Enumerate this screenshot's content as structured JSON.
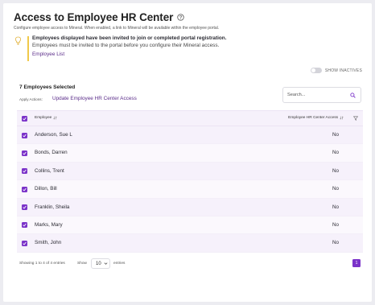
{
  "header": {
    "title": "Access to Employee HR Center",
    "subtitle": "Configure employee access to Mineral. When enabled, a link to Mineral will be available within the employee portal."
  },
  "info": {
    "title": "Employees displayed have been invited to join or completed portal registration.",
    "description": "Employees must be invited to the portal before you configure their Mineral access.",
    "link": "Employee List"
  },
  "toggle": {
    "label": "SHOW INACTIVES",
    "on": false
  },
  "card": {
    "selected_count": "7 Employees Selected",
    "apply_label": "Apply Actions:",
    "apply_link": "Update Employee HR Center Access",
    "search": {
      "placeholder": "Search...",
      "value": ""
    }
  },
  "table": {
    "columns": {
      "employee": "Employee",
      "access": "Employee HR Center Access"
    },
    "rows": [
      {
        "name": "Anderson, Sue L",
        "access": "No",
        "checked": true
      },
      {
        "name": "Bonds, Darren",
        "access": "No",
        "checked": true
      },
      {
        "name": "Collins, Trent",
        "access": "No",
        "checked": true
      },
      {
        "name": "Dillon, Bill",
        "access": "No",
        "checked": true
      },
      {
        "name": "Franklin, Sheila",
        "access": "No",
        "checked": true
      },
      {
        "name": "Marks, Mary",
        "access": "No",
        "checked": true
      },
      {
        "name": "Smith, John",
        "access": "No",
        "checked": true
      }
    ]
  },
  "footer": {
    "showing": "Showing 1 to 4 of 4 entries",
    "show_label": "Show",
    "page_size": "10",
    "entries_label": "entries",
    "current_page": "1"
  },
  "colors": {
    "accent": "#7b33c9",
    "link": "#5b2d8a",
    "info_bar": "#f0c94a",
    "row_tint": "#f6f1fb"
  },
  "icons": [
    "help-circle-icon",
    "lightbulb-icon",
    "search-icon",
    "sort-icon",
    "filter-icon",
    "chevron-down-icon",
    "check-icon"
  ]
}
